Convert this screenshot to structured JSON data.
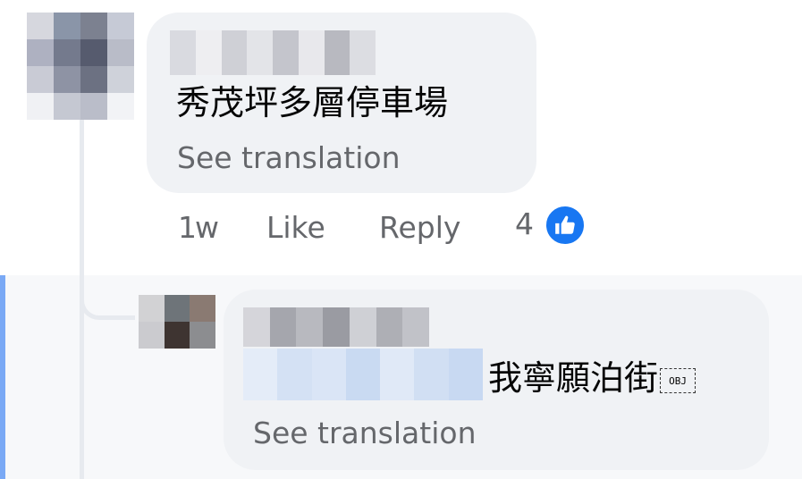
{
  "comment": {
    "text": "秀茂坪多層停車場",
    "see_translation": "See translation",
    "actions": {
      "time": "1w",
      "like": "Like",
      "reply": "Reply",
      "reaction_count": "4"
    },
    "avatar_colors": [
      "#d6d7de",
      "#8a95a8",
      "#7c8190",
      "#c6cad6",
      "#aeb1c1",
      "#747a8d",
      "#565b6e",
      "#b9bcc8",
      "#c9cbd5",
      "#8e93a4",
      "#6c7182",
      "#cfd2da",
      "#f0f1f4",
      "#c5c8d2",
      "#babdc9",
      "#f2f3f6"
    ],
    "name_blur_colors": [
      "#d9dae0",
      "#eeeef1",
      "#cfd0d6",
      "#e3e4e8",
      "#c4c5cc",
      "#e8e8ec",
      "#b8b9c0",
      "#dcdde2"
    ]
  },
  "reply": {
    "text": "我寧願泊街",
    "placeholder_glyph": "OBJ",
    "see_translation": "See translation",
    "avatar_colors": [
      "#d2d2d4",
      "#6e7479",
      "#8a7a72",
      "#cbcbcf",
      "#3e3431",
      "#8c8d90"
    ],
    "name_blur_colors": [
      "#d5d5da",
      "#a5a6ad",
      "#b8b9bf",
      "#9a9ba2",
      "#cfd0d5",
      "#aeafb5",
      "#c1c2c8"
    ],
    "mention_blur_colors": [
      "#e4ecf8",
      "#d4e1f4",
      "#dae5f6",
      "#c9daf2",
      "#e0e9f7",
      "#d1dff3",
      "#c8d9f2"
    ]
  },
  "colors": {
    "bubble": "#f0f2f5",
    "secondary_text": "#65676b",
    "like_blue": "#1877f2",
    "accent_bar": "#7aa9f5"
  }
}
